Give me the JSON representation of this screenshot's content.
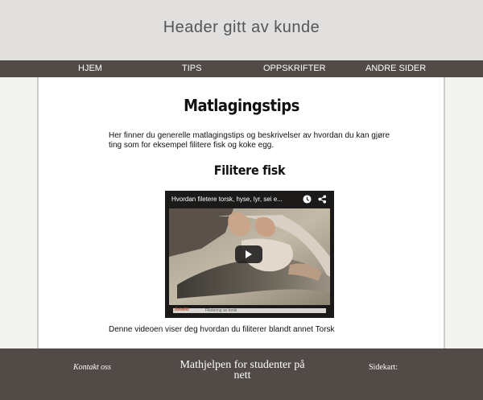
{
  "header": {
    "title": "Header gitt av kunde"
  },
  "nav": {
    "items": [
      {
        "label": "HJEM"
      },
      {
        "label": "TIPS"
      },
      {
        "label": "OPPSKRIFTER"
      },
      {
        "label": "ANDRE SIDER"
      }
    ]
  },
  "main": {
    "title": "Matlagingstips",
    "intro": "Her finner du generelle matlagingstips og beskrivelser av hvordan du kan gjøre ting som for eksempel filitere fisk og koke egg.",
    "section_title": "Filitere fisk",
    "video": {
      "title": "Hvordan filetere torsk, hyse, lyr, sei e...",
      "brand": "howto",
      "bar_text": "Filetering av torsk"
    },
    "caption": "Denne videoen viser deg hvordan du filiterer blandt annet Torsk"
  },
  "footer": {
    "contact": "Kontakt oss",
    "title": "Mathjelpen for studenter på nett",
    "sitemap": "Sidekart:"
  },
  "colors": {
    "header_bg": "#e2dfdf",
    "nav_bg": "#514a47",
    "footer_bg": "#514a47",
    "page_bg": "#f3f4ef"
  }
}
